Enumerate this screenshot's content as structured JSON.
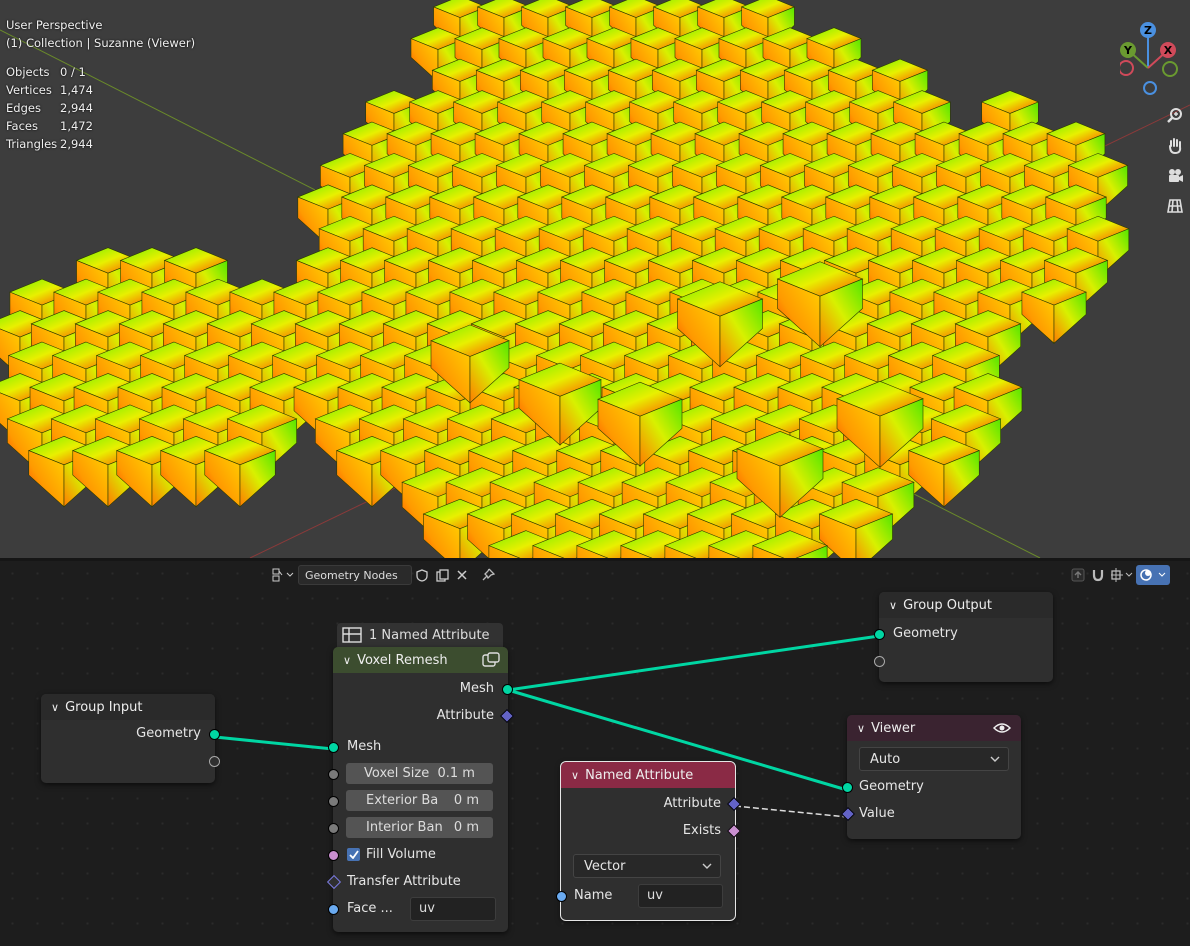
{
  "viewport": {
    "perspective": "User Perspective",
    "collection": "(1) Collection | Suzanne (Viewer)",
    "stats": [
      {
        "label": "Objects",
        "value": "0 / 1"
      },
      {
        "label": "Vertices",
        "value": "1,474"
      },
      {
        "label": "Edges",
        "value": "2,944"
      },
      {
        "label": "Faces",
        "value": "1,472"
      },
      {
        "label": "Triangles",
        "value": "2,944"
      }
    ],
    "gizmo": {
      "z": "Z",
      "y": "Y",
      "x": "X"
    }
  },
  "node_editor": {
    "tree_name": "Geometry Nodes",
    "nodes": {
      "group_input": {
        "title": "Group Input",
        "output_geometry": "Geometry"
      },
      "frame_label": "1 Named Attribute",
      "voxel_remesh": {
        "title": "Voxel Remesh",
        "out_mesh": "Mesh",
        "out_attribute": "Attribute",
        "in_mesh": "Mesh",
        "voxel_size_label": "Voxel Size",
        "voxel_size_value": "0.1 m",
        "exterior_label": "Exterior Ba",
        "exterior_value": "0 m",
        "interior_label": "Interior Ban",
        "interior_value": "0 m",
        "fill_volume": "Fill Volume",
        "transfer_attribute": "Transfer Attribute",
        "face_label": "Face ...",
        "face_value": "uv"
      },
      "group_output": {
        "title": "Group Output",
        "input_geometry": "Geometry"
      },
      "viewer": {
        "title": "Viewer",
        "domain": "Auto",
        "in_geometry": "Geometry",
        "in_value": "Value"
      },
      "named_attribute": {
        "title": "Named Attribute",
        "out_attribute": "Attribute",
        "out_exists": "Exists",
        "type": "Vector",
        "name_label": "Name",
        "name_value": "uv"
      }
    }
  },
  "colors": {
    "geometry_socket": "#00d6a3",
    "vector_socket": "#6363c7",
    "bool_socket": "#c98fd0",
    "string_socket": "#6aaaf0",
    "geometry_node_header": "#3c4d2f",
    "attribute_node_header": "#8a2a45",
    "output_node_header": "#3a2330",
    "accent": "#4772b3"
  }
}
